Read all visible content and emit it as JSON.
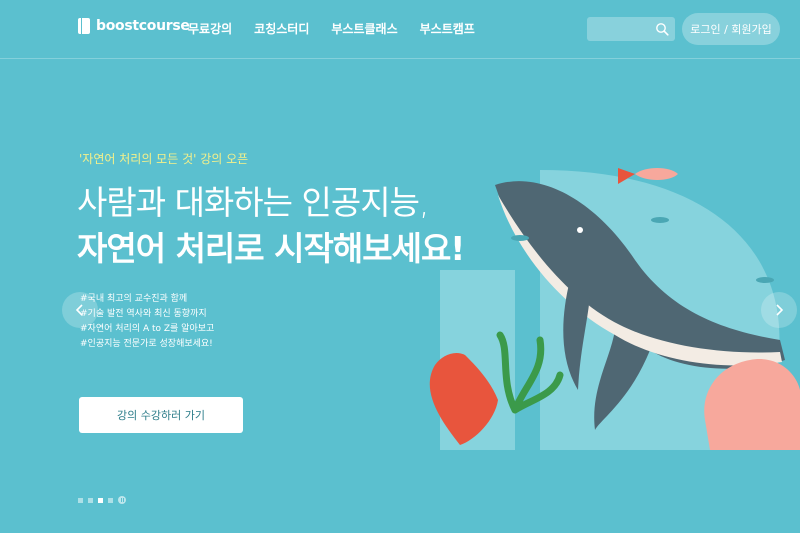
{
  "header": {
    "logo": "boostcourse",
    "nav": [
      "무료강의",
      "코칭스터디",
      "부스트클래스",
      "부스트캠프"
    ],
    "search_placeholder": "",
    "login_label": "로그인 / 회원가입"
  },
  "hero": {
    "tagline": "'자연어 처리의 모든 것' 강의 오픈",
    "headline_line1": "사람과 대화하는 인공지능,",
    "headline_line2": "자연어 처리로 시작해보세요!",
    "bullets": [
      "#국내 최고의 교수진과 함께",
      "#기술 발전 역사와 최신 동향까지",
      "#자연어 처리의 A to Z를 알아보고",
      "#인공지능 전문가로 성장해보세요!"
    ],
    "cta_label": "강의 수강하러 가기"
  },
  "carousel": {
    "slide_count": 4,
    "active_index": 2
  },
  "colors": {
    "background": "#5bc0cf",
    "tagline": "#f4f08a",
    "whale": "#4f6773",
    "coral_red": "#e8553d",
    "coral_pink": "#f7a89c",
    "seaweed": "#3b9a4a",
    "letter_shape": "#8ed6df"
  },
  "icons": {
    "search": "search-icon",
    "prev": "chevron-left-icon",
    "next": "chevron-right-icon",
    "pause": "pause-icon"
  }
}
